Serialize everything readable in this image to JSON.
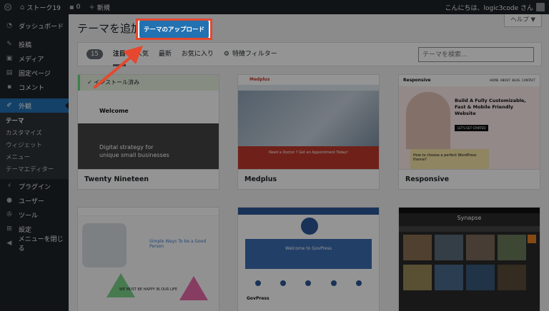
{
  "adminbar": {
    "site_name": "ストーク19",
    "comments_count": "0",
    "new_label": "新規",
    "greeting": "こんにちは、logic3code さん"
  },
  "sidebar": {
    "items": [
      {
        "label": "ダッシュボード",
        "icon": "dashboard-icon"
      },
      {
        "label": "投稿",
        "icon": "pin-icon"
      },
      {
        "label": "メディア",
        "icon": "media-icon"
      },
      {
        "label": "固定ページ",
        "icon": "page-icon"
      },
      {
        "label": "コメント",
        "icon": "comment-icon"
      },
      {
        "label": "外観",
        "icon": "brush-icon"
      }
    ],
    "submenu": [
      "テーマ",
      "カスタマイズ",
      "ウィジェット",
      "メニュー",
      "テーマエディター"
    ],
    "items_after": [
      {
        "label": "プラグイン",
        "icon": "plugin-icon"
      },
      {
        "label": "ユーザー",
        "icon": "user-icon"
      },
      {
        "label": "ツール",
        "icon": "tool-icon"
      },
      {
        "label": "設定",
        "icon": "settings-icon"
      },
      {
        "label": "メニューを閉じる",
        "icon": "collapse-icon"
      }
    ]
  },
  "header": {
    "title": "テーマを追加",
    "upload_label": "テーマのアップロード",
    "help_label": "ヘルプ ▼"
  },
  "filter": {
    "count": "15",
    "tabs": [
      "注目",
      "人気",
      "最新",
      "お気に入り"
    ],
    "feature_label": "特徴フィルター",
    "search_placeholder": "テーマを検索..."
  },
  "themes": [
    {
      "name": "Twenty Nineteen",
      "installed_label": "インストール済み",
      "welcome": "Welcome",
      "hero_line1": "Digital strategy for",
      "hero_line2": "unique small businesses"
    },
    {
      "name": "Medplus",
      "brand": "Medplus",
      "hero": "Need a Doctor ? Get an Appointment Today!"
    },
    {
      "name": "Responsive",
      "brand": "Responsive",
      "nav": [
        "HOME",
        "ABOUT",
        "BLOG",
        "CONTACT"
      ],
      "heading": "Build A Fully Customizable, Fast & Mobile Friendly Website",
      "cta": "LET'S GET STARTED",
      "sub": "How to choose a perfect WordPress theme?"
    },
    {
      "name": "",
      "tagline": "Simple Ways To be a Good Person",
      "foot": "WE MUST BE HAPPY IN OUR LIFE"
    },
    {
      "name": "",
      "hero": "Welcome to GovPress",
      "brand": "GovPress"
    },
    {
      "name": "",
      "brand": "Synapse"
    }
  ],
  "colors": {
    "admin_dark": "#1d2327",
    "accent": "#2271b1",
    "highlight": "#e5482e"
  }
}
